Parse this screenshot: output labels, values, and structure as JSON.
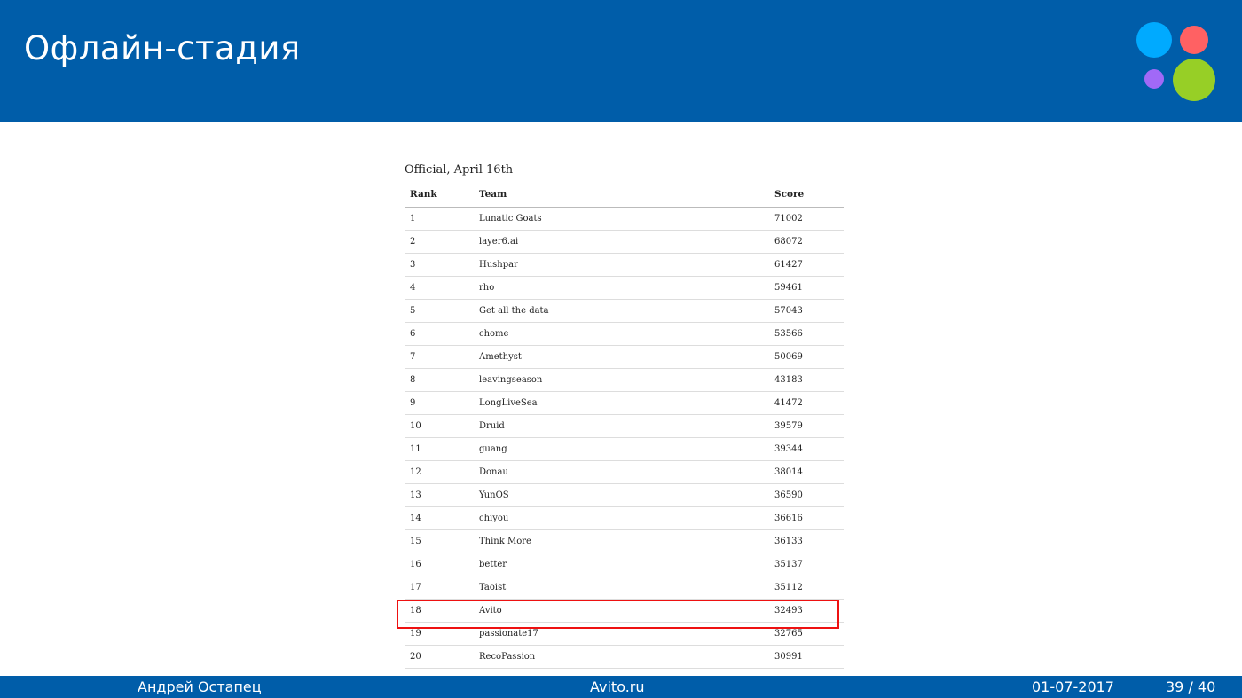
{
  "slide": {
    "title": "Офлайн-стадия"
  },
  "logo": {
    "icon": "avito-dots-logo",
    "colors": [
      "#00aaff",
      "#ff6163",
      "#a169f7",
      "#97cf26"
    ]
  },
  "leaderboard": {
    "title": "Official, April 16th",
    "columns": {
      "rank": "Rank",
      "team": "Team",
      "score": "Score"
    },
    "rows": [
      {
        "rank": "1",
        "team": "Lunatic Goats",
        "score": "71002"
      },
      {
        "rank": "2",
        "team": "layer6.ai",
        "score": "68072"
      },
      {
        "rank": "3",
        "team": "Hushpar",
        "score": "61427"
      },
      {
        "rank": "4",
        "team": "rho",
        "score": "59461"
      },
      {
        "rank": "5",
        "team": "Get all the data",
        "score": "57043"
      },
      {
        "rank": "6",
        "team": "chome",
        "score": "53566"
      },
      {
        "rank": "7",
        "team": "Amethyst",
        "score": "50069"
      },
      {
        "rank": "8",
        "team": "leavingseason",
        "score": "43183"
      },
      {
        "rank": "9",
        "team": "LongLiveSea",
        "score": "41472"
      },
      {
        "rank": "10",
        "team": "Druid",
        "score": "39579"
      },
      {
        "rank": "11",
        "team": "guang",
        "score": "39344"
      },
      {
        "rank": "12",
        "team": "Donau",
        "score": "38014"
      },
      {
        "rank": "13",
        "team": "YunOS",
        "score": "36590"
      },
      {
        "rank": "14",
        "team": "chiyou",
        "score": "36616"
      },
      {
        "rank": "15",
        "team": "Think More",
        "score": "36133"
      },
      {
        "rank": "16",
        "team": "better",
        "score": "35137"
      },
      {
        "rank": "17",
        "team": "Taoist",
        "score": "35112"
      },
      {
        "rank": "18",
        "team": "Avito",
        "score": "32493"
      },
      {
        "rank": "19",
        "team": "passionate17",
        "score": "32765"
      },
      {
        "rank": "20",
        "team": "RecoPassion",
        "score": "30991"
      }
    ],
    "highlight_color": "#ee1111"
  },
  "footer": {
    "author": "Андрей Остапец",
    "site": "Avito.ru",
    "date": "01-07-2017",
    "page": "39 / 40"
  },
  "colors": {
    "brand_blue": "#005da9"
  }
}
